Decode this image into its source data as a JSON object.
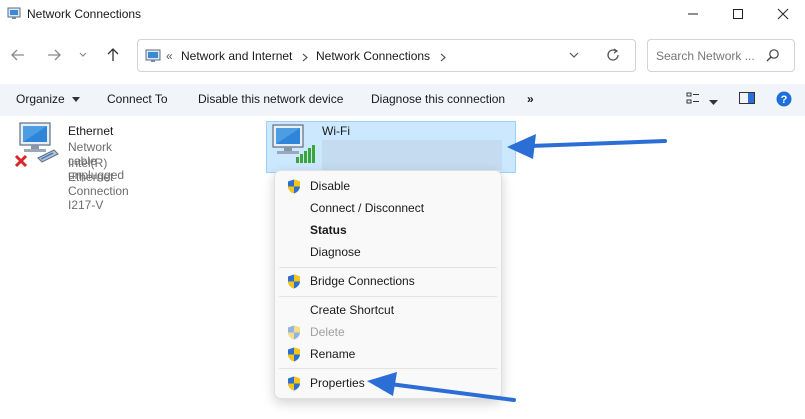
{
  "window": {
    "title": "Network Connections"
  },
  "address": {
    "segments": [
      "Network and Internet",
      "Network Connections"
    ]
  },
  "search": {
    "placeholder": "Search Network ..."
  },
  "toolbar": {
    "items": [
      "Organize",
      "Connect To",
      "Disable this network device",
      "Diagnose this connection"
    ],
    "more": "»"
  },
  "connections": {
    "ethernet": {
      "name": "Ethernet",
      "status": "Network cable unplugged",
      "device": "Intel(R) Ethernet Connection I217-V"
    },
    "wifi": {
      "name": "Wi-Fi",
      "selected": true
    }
  },
  "context_menu": {
    "items": [
      {
        "label": "Disable",
        "shield": true
      },
      {
        "label": "Connect / Disconnect",
        "shield": false
      },
      {
        "label": "Status",
        "shield": false,
        "bold": true
      },
      {
        "label": "Diagnose",
        "shield": false
      },
      {
        "label": "Bridge Connections",
        "shield": true
      },
      {
        "label": "Create Shortcut",
        "shield": false
      },
      {
        "label": "Delete",
        "shield": true,
        "disabled": true
      },
      {
        "label": "Rename",
        "shield": true
      },
      {
        "label": "Properties",
        "shield": true
      }
    ]
  },
  "colors": {
    "accent_arrow": "#2b6fd6",
    "selection": "#cce8ff",
    "toolbar_bg": "#f1f4f9",
    "help_icon": "#1e6fd9"
  }
}
